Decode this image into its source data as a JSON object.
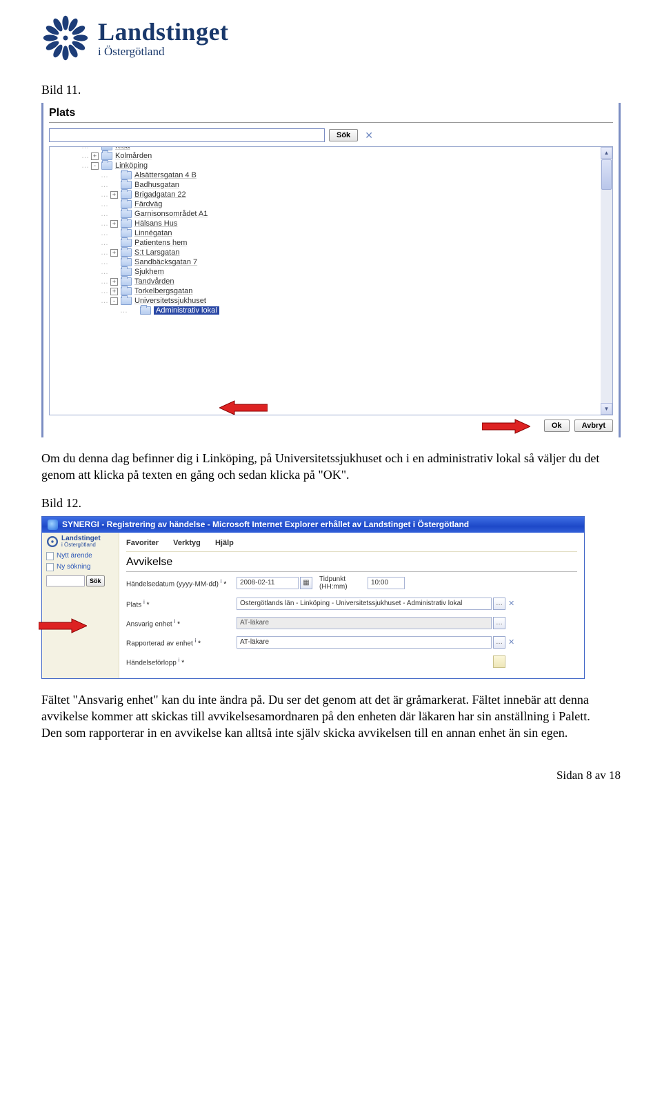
{
  "org": {
    "name": "Landstinget",
    "subname": "i Östergötland"
  },
  "captions": {
    "bild11": "Bild 11.",
    "bild12": "Bild 12."
  },
  "paragraphs": {
    "p1": "Om du denna dag befinner dig i Linköping, på Universitetssjukhuset och i en administrativ lokal så väljer du det genom att klicka på texten en gång och sedan klicka på \"OK\".",
    "p2": "Fältet \"Ansvarig enhet\" kan du inte ändra på. Du ser det genom att det är gråmarkerat. Fältet innebär att denna avvikelse kommer att skickas till avvikelsesamordnaren på den enheten där läkaren har sin anställning i Palett. Den som rapporterar in en avvikelse kan alltså inte själv skicka avvikelsen till en annan enhet än sin egen."
  },
  "shot1": {
    "title": "Plats",
    "search_btn": "Sök",
    "ok_btn": "Ok",
    "cancel_btn": "Avbryt",
    "tree": [
      {
        "indent": 1,
        "toggle": "",
        "label": "Kisa",
        "cutoff": true
      },
      {
        "indent": 1,
        "toggle": "+",
        "label": "Kolmården"
      },
      {
        "indent": 1,
        "toggle": "-",
        "label": "Linköping"
      },
      {
        "indent": 2,
        "toggle": "",
        "label": "Alsättersgatan 4 B"
      },
      {
        "indent": 2,
        "toggle": "",
        "label": "Badhusgatan"
      },
      {
        "indent": 2,
        "toggle": "+",
        "label": "Brigadgatan 22"
      },
      {
        "indent": 2,
        "toggle": "",
        "label": "Färdväg"
      },
      {
        "indent": 2,
        "toggle": "",
        "label": "Garnisonsområdet A1"
      },
      {
        "indent": 2,
        "toggle": "+",
        "label": "Hälsans Hus"
      },
      {
        "indent": 2,
        "toggle": "",
        "label": "Linnégatan"
      },
      {
        "indent": 2,
        "toggle": "",
        "label": "Patientens hem"
      },
      {
        "indent": 2,
        "toggle": "+",
        "label": "S:t Larsgatan"
      },
      {
        "indent": 2,
        "toggle": "",
        "label": "Sandbäcksgatan 7"
      },
      {
        "indent": 2,
        "toggle": "",
        "label": "Sjukhem"
      },
      {
        "indent": 2,
        "toggle": "+",
        "label": "Tandvården"
      },
      {
        "indent": 2,
        "toggle": "+",
        "label": "Torkelbergsgatan"
      },
      {
        "indent": 2,
        "toggle": "-",
        "label": "Universitetssjukhuset"
      },
      {
        "indent": 3,
        "toggle": "",
        "label": "Administrativ lokal",
        "selected": true
      }
    ]
  },
  "shot2": {
    "window_title": "SYNERGI - Registrering av händelse - Microsoft Internet Explorer erhållet av Landstinget i Östergötland",
    "sidebar": {
      "brand": "Landstinget",
      "brand_sub": "i Östergötland",
      "new_case": "Nytt ärende",
      "new_search": "Ny sökning",
      "search_btn": "Sök"
    },
    "menu": {
      "fav": "Favoriter",
      "tools": "Verktyg",
      "help": "Hjälp"
    },
    "form": {
      "title": "Avvikelse",
      "row_date_label": "Händelsedatum (yyyy-MM-dd)",
      "row_date_value": "2008-02-11",
      "row_time_label": "Tidpunkt (HH:mm)",
      "row_time_value": "10:00",
      "row_plats_label": "Plats",
      "row_plats_value": "Östergötlands län - Linköping - Universitetssjukhuset - Administrativ lokal",
      "row_ansvarig_label": "Ansvarig enhet",
      "row_ansvarig_value": "AT-läkare",
      "row_rapp_label": "Rapporterad av enhet",
      "row_rapp_value": "AT-läkare",
      "row_handelse_label": "Händelseförlopp",
      "info_sup": "i",
      "ast": "*"
    }
  },
  "footer": "Sidan 8 av 18"
}
